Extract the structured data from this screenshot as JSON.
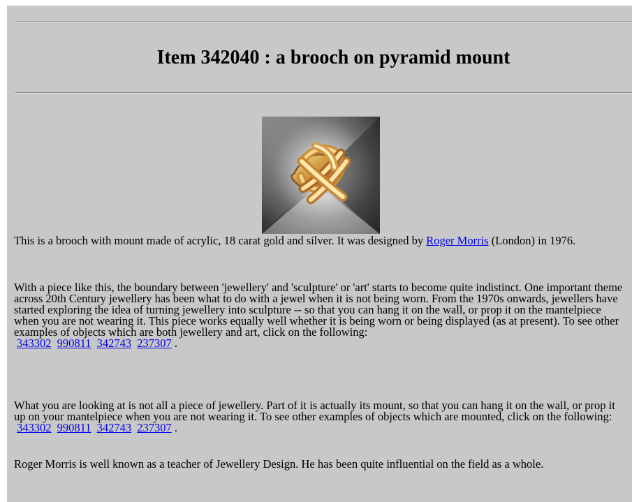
{
  "item": {
    "title": "Item 342040 : a brooch on pyramid mount"
  },
  "colors": {
    "background": "#c8c8c8",
    "link": "#0000ee"
  },
  "image": {
    "name": "brooch-photo"
  },
  "paragraph1": {
    "before_link": "This is a brooch with mount made of acrylic, 18 carat gold and silver. It was designed by ",
    "designer_link": "Roger Morris",
    "after_link": " (London) in 1976."
  },
  "paragraph2": {
    "text": "With a piece like this, the boundary between 'jewellery' and 'sculpture' or 'art' starts to become quite indistinct. One important theme across 20th Century jewellery has been what to do with a jewel when it is not being worn. From the 1970s onwards, jewellers have started exploring the idea of turning jewellery into sculpture -- so that you can hang it on the wall, or prop it on the mantelpiece when you are not wearing it. This piece works equally well whether it is being worn or being displayed (as at present). To see other examples of objects which are both jewellery and art, click on the following:",
    "links": [
      "343302",
      "990811",
      "342743",
      "237307"
    ],
    "end": "."
  },
  "paragraph3": {
    "text": "What you are looking at is not all a piece of jewellery. Part of it is actually its mount, so that you can hang it on the wall, or prop it up on your mantelpiece when you are not wearing it. To see other examples of objects which are mounted, click on the following:",
    "links": [
      "343302",
      "990811",
      "342743",
      "237307"
    ],
    "end": "."
  },
  "paragraph4": {
    "text": "Roger Morris is well known as a teacher of Jewellery Design. He has been quite influential on the field as a whole."
  }
}
